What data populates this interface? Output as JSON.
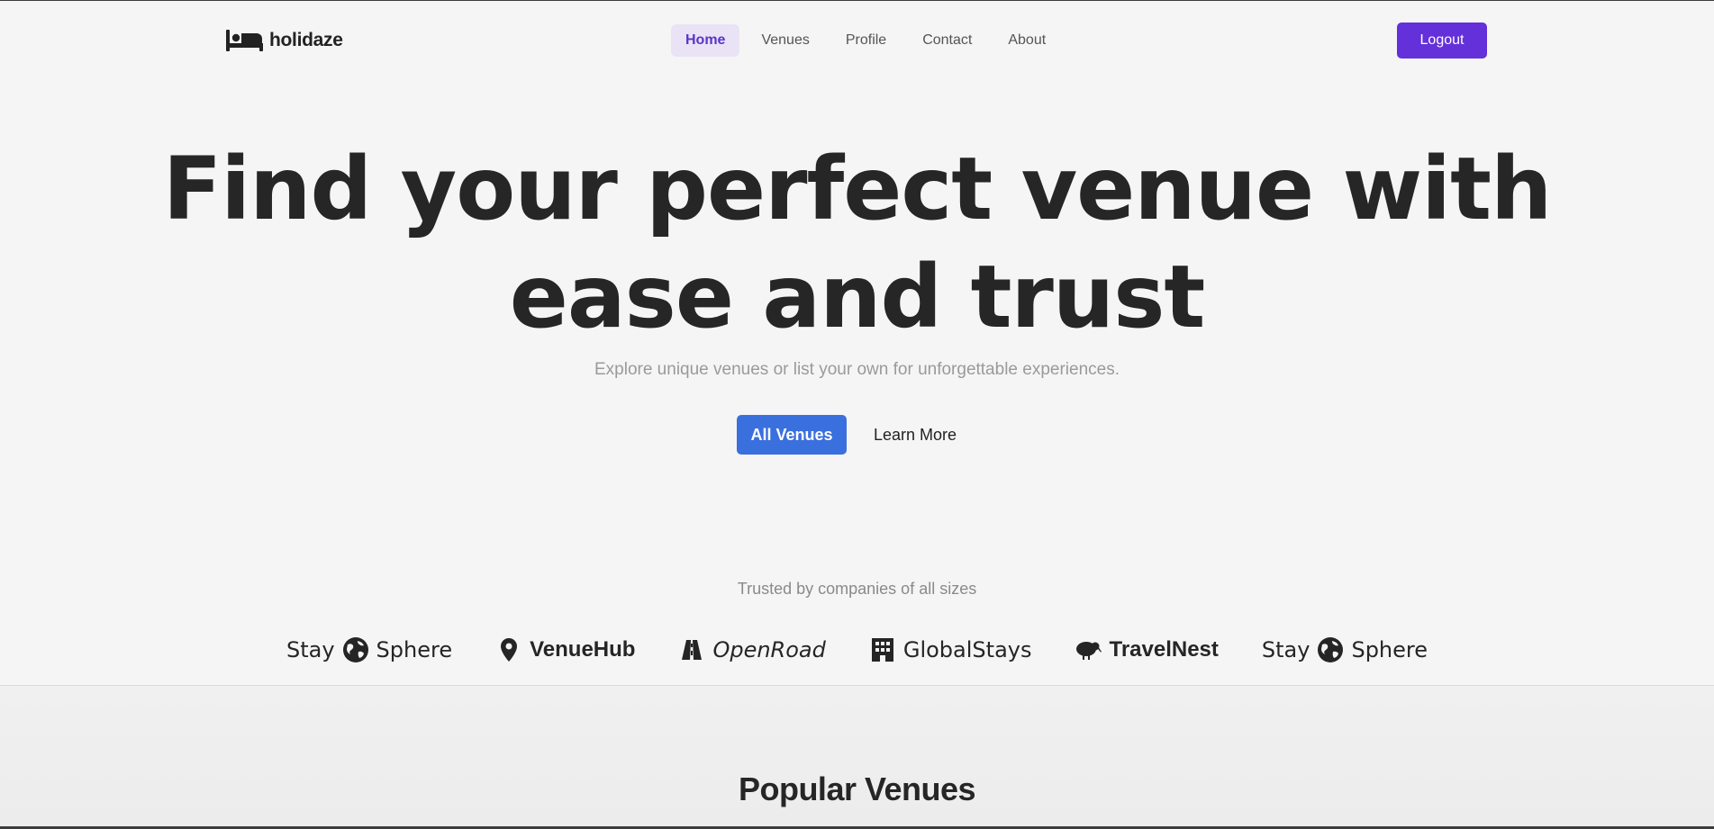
{
  "brand": {
    "name": "holidaze",
    "icon": "bed-icon"
  },
  "nav": {
    "items": [
      {
        "label": "Home",
        "active": true
      },
      {
        "label": "Venues",
        "active": false
      },
      {
        "label": "Profile",
        "active": false
      },
      {
        "label": "Contact",
        "active": false
      },
      {
        "label": "About",
        "active": false
      }
    ],
    "logout_label": "Logout"
  },
  "hero": {
    "title_line1": "Find your perfect venue with",
    "title_line2": "ease and trust",
    "subtitle": "Explore unique venues or list your own for unforgettable experiences.",
    "primary_cta": "All Venues",
    "secondary_cta": "Learn More"
  },
  "trusted": {
    "caption": "Trusted by companies of all sizes",
    "brands": [
      {
        "pre": "Stay",
        "post": "Sphere",
        "icon": "globe-icon"
      },
      {
        "label": "VenueHub",
        "icon": "map-pin-icon"
      },
      {
        "label": "OpenRoad",
        "icon": "road-icon"
      },
      {
        "label": "GlobalStays",
        "icon": "building-icon"
      },
      {
        "label": "TravelNest",
        "icon": "kiwi-bird-icon"
      },
      {
        "pre": "Stay",
        "post": "Sphere",
        "icon": "globe-icon"
      }
    ]
  },
  "popular": {
    "title": "Popular Venues"
  },
  "colors": {
    "accent": "#6330d9",
    "primary": "#3a6fde",
    "active_nav_bg": "#e9e3f5"
  }
}
